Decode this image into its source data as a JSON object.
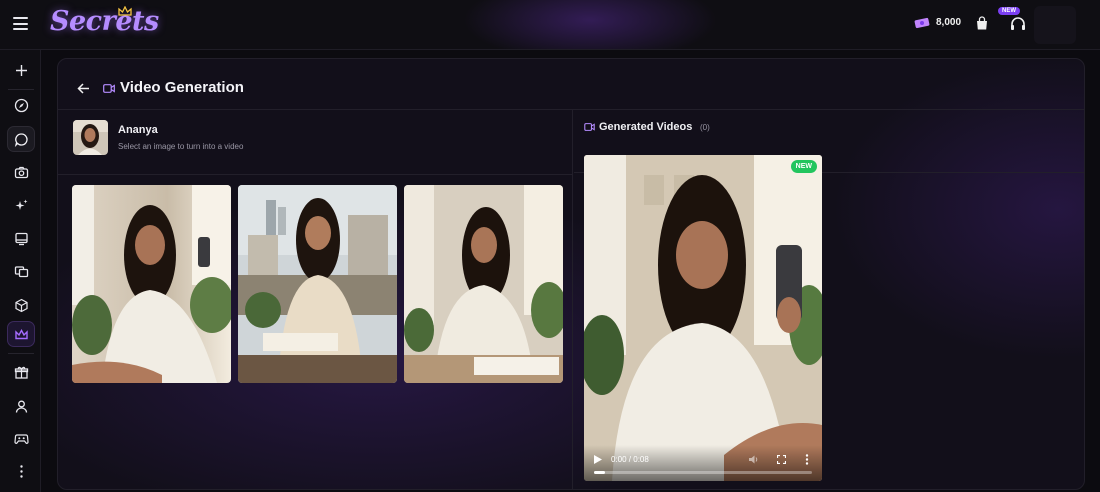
{
  "app": {
    "logo": "Secrets",
    "coins": "8,000",
    "new_badge": "NEW",
    "accent": "#b58cff"
  },
  "sidebar": {
    "items": [
      {
        "icon": "plus-icon"
      },
      {
        "icon": "compass-icon"
      },
      {
        "icon": "chat-bubble-icon",
        "active": true
      },
      {
        "icon": "camera-icon"
      },
      {
        "icon": "sparkles-icon"
      },
      {
        "icon": "gallery-icon"
      },
      {
        "icon": "cards-icon"
      },
      {
        "icon": "cube-icon"
      },
      {
        "icon": "crown-icon",
        "premium": true
      },
      {
        "icon": "gift-icon"
      },
      {
        "icon": "user-icon"
      },
      {
        "icon": "gamepad-icon"
      },
      {
        "icon": "more-vertical-icon"
      }
    ]
  },
  "page": {
    "title": "Video Generation"
  },
  "character": {
    "name": "Ananya",
    "subtitle": "Select an image to turn into a video"
  },
  "images": [
    {
      "icon": "photo-selfie-balcony"
    },
    {
      "icon": "photo-sitting-writing"
    },
    {
      "icon": "photo-drawing-table"
    }
  ],
  "generated": {
    "title": "Generated Videos",
    "count": "(0)",
    "video": {
      "badge": "NEW",
      "time": "0:00 / 0:08",
      "progress": 0.05
    }
  }
}
